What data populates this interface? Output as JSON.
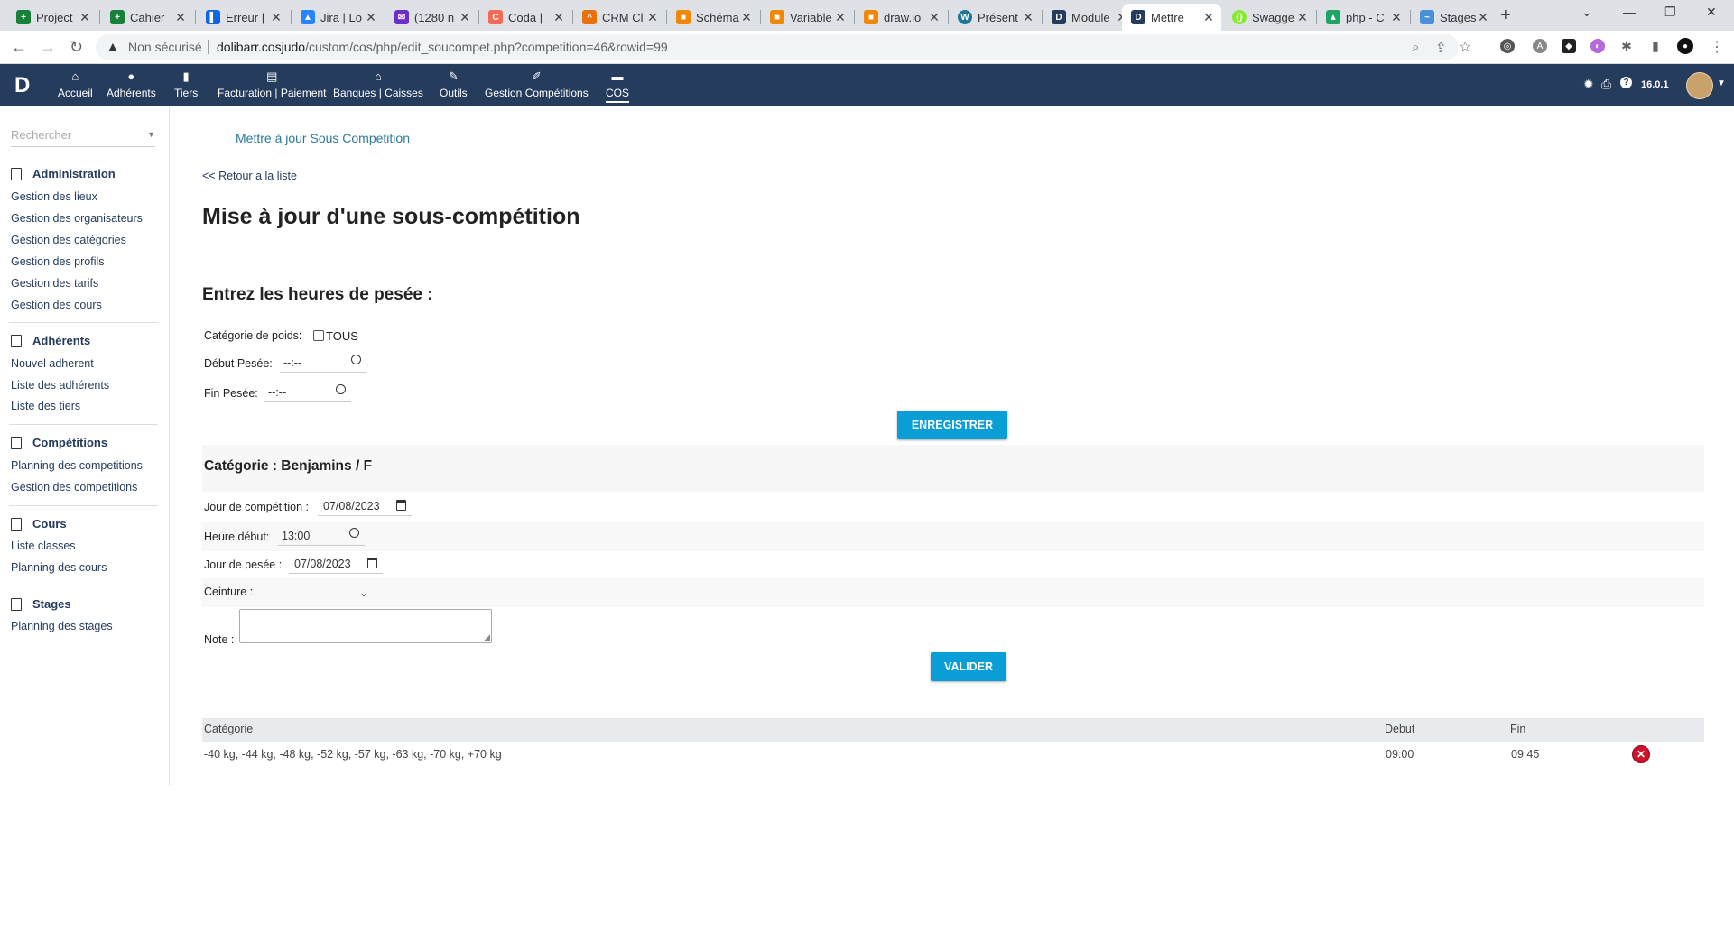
{
  "browser": {
    "tabs": [
      {
        "title": "Project",
        "icon": "sheets-icon",
        "color": "#188038"
      },
      {
        "title": "Cahier",
        "icon": "sheets-icon",
        "color": "#188038"
      },
      {
        "title": "Erreur |",
        "icon": "trello-icon",
        "color": "#0c66e4"
      },
      {
        "title": "Jira | Lo",
        "icon": "jira-icon",
        "color": "#2684ff"
      },
      {
        "title": "(1280 n",
        "icon": "mail-icon",
        "color": "#6d2ec7"
      },
      {
        "title": "Coda |",
        "icon": "coda-icon",
        "color": "#f46a54"
      },
      {
        "title": "CRM Cl",
        "icon": "crm-icon",
        "color": "#e8710a"
      },
      {
        "title": "Schéma",
        "icon": "drawio-icon",
        "color": "#f08705"
      },
      {
        "title": "Variable",
        "icon": "drawio-icon",
        "color": "#f08705"
      },
      {
        "title": "draw.io",
        "icon": "drawio-icon",
        "color": "#f08705"
      },
      {
        "title": "Présent",
        "icon": "wordpress-icon",
        "color": "#21759b"
      },
      {
        "title": "Module",
        "icon": "dolibarr-icon",
        "color": "#263c5c"
      },
      {
        "title": "Mettre",
        "icon": "dolibarr-icon",
        "color": "#263c5c",
        "active": true
      },
      {
        "title": "Swagge",
        "icon": "swagger-icon",
        "color": "#85ea2d"
      },
      {
        "title": "php - C",
        "icon": "drive-icon",
        "color": "#1fa463"
      },
      {
        "title": "Stages",
        "icon": "stages-icon",
        "color": "#4a90d9"
      }
    ],
    "security_label": "Non sécurisé",
    "url_host": "dolibarr.cosjudo",
    "url_path": "/custom/cos/php/edit_soucompet.php?competition=46&rowid=99"
  },
  "topmenu": {
    "items": [
      {
        "label": "Accueil",
        "icon": "home-icon"
      },
      {
        "label": "Adhérents",
        "icon": "user-icon"
      },
      {
        "label": "Tiers",
        "icon": "building-icon"
      },
      {
        "label": "Facturation | Paiement",
        "icon": "money-icon"
      },
      {
        "label": "Banques | Caisses",
        "icon": "bank-icon"
      },
      {
        "label": "Outils",
        "icon": "wrench-icon"
      },
      {
        "label": "Gestion Compétitions",
        "icon": "edit-icon"
      },
      {
        "label": "COS",
        "icon": "doc-icon",
        "selected": true
      }
    ],
    "version": "16.0.1"
  },
  "sidebar": {
    "search_placeholder": "Rechercher",
    "sections": [
      {
        "title": "Administration",
        "items": [
          "Gestion des lieux",
          "Gestion des organisateurs",
          "Gestion des catégories",
          "Gestion des profils",
          "Gestion des tarifs",
          "Gestion des cours"
        ]
      },
      {
        "title": "Adhérents",
        "items": [
          "Nouvel adherent",
          "Liste des adhérents",
          "Liste des tiers"
        ]
      },
      {
        "title": "Compétitions",
        "items": [
          "Planning des competitions",
          "Gestion des competitions"
        ]
      },
      {
        "title": "Cours",
        "items": [
          "Liste classes",
          "Planning des cours"
        ]
      },
      {
        "title": "Stages",
        "items": [
          "Planning des stages"
        ]
      }
    ]
  },
  "main": {
    "subtitle": "Mettre à jour Sous Competition",
    "back_link": "<< Retour a la liste",
    "title": "Mise à jour d'une sous-compétition",
    "weigh_title": "Entrez les heures de pesée :",
    "weight_cat_label": "Catégorie de poids:",
    "weight_cat_option": "TOUS",
    "debut_pesee_label": "Début Pesée:",
    "debut_pesee_value": "--:--",
    "fin_pesee_label": "Fin Pesée:",
    "fin_pesee_value": "--:--",
    "save_button": "ENREGISTRER",
    "category_title": "Catégorie : Benjamins / F",
    "jour_competition_label": "Jour de compétition :",
    "jour_competition_value": "07/08/2023",
    "heure_debut_label": "Heure début:",
    "heure_debut_value": "13:00",
    "jour_pesee_label": "Jour de pesée :",
    "jour_pesee_value": "07/08/2023",
    "ceinture_label": "Ceinture :",
    "note_label": "Note :",
    "validate_button": "VALIDER",
    "table": {
      "headers": [
        "Catégorie",
        "Debut",
        "Fin"
      ],
      "rows": [
        {
          "categorie": "-40 kg, -44 kg, -48 kg, -52 kg, -57 kg, -63 kg, -70 kg, +70 kg",
          "debut": "09:00",
          "fin": "09:45"
        }
      ]
    }
  }
}
